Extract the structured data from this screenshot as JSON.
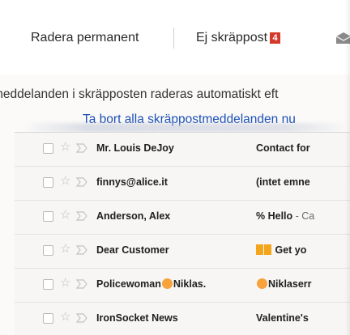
{
  "toolbar": {
    "delete_forever": "Radera permanent",
    "not_spam": "Ej skräppost",
    "badge": "4"
  },
  "notice": {
    "text": "meddelanden i skräpposten raderas automatiskt eft",
    "delete_all": "Ta bort alla skräppostmeddelanden nu"
  },
  "emails": [
    {
      "sender": "Mr. Louis DeJoy",
      "subject": "Contact for",
      "snippet": ""
    },
    {
      "sender": "finnys@alice.it",
      "subject": "(intet emne",
      "snippet": ""
    },
    {
      "sender": "Anderson, Alex",
      "subject": "% Hello",
      "snippet": " - Ca"
    },
    {
      "sender": "Dear Customer",
      "subject": "Get yo",
      "snippet": ""
    },
    {
      "sender_prefix": "Policewoman",
      "sender_suffix": "Niklas.",
      "subject": "Niklaserr",
      "snippet": ""
    },
    {
      "sender": "IronSocket News",
      "subject": "Valentine's",
      "snippet": ""
    }
  ],
  "colors": {
    "link": "#1a4fb6",
    "badge": "#d33a2c",
    "text": "#202020"
  },
  "icons": {
    "checkbox": "checkbox-icon",
    "star": "star-icon",
    "importance": "importance-marker-icon",
    "envelope": "envelope-icon"
  }
}
